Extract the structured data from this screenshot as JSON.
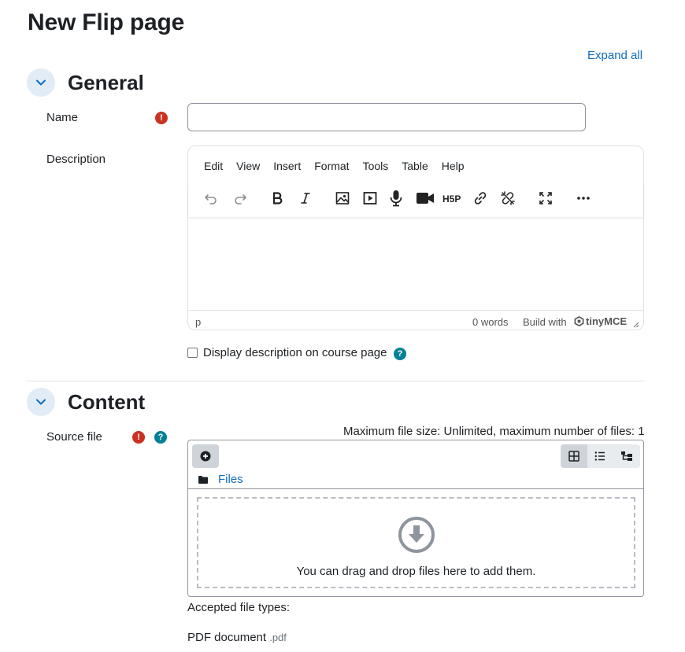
{
  "page": {
    "title": "New Flip page",
    "expand_all": "Expand all"
  },
  "general": {
    "section_title": "General",
    "name_label": "Name",
    "name_value": "",
    "description_label": "Description",
    "editor": {
      "menu": [
        "Edit",
        "View",
        "Insert",
        "Format",
        "Tools",
        "Table",
        "Help"
      ],
      "status_path": "p",
      "word_count": "0 words",
      "build_with": "Build with",
      "brand": "tinyMCE"
    },
    "display_description_label": "Display description on course page",
    "display_description_checked": false
  },
  "content": {
    "section_title": "Content",
    "source_file_label": "Source file",
    "max_file_size": "Maximum file size: Unlimited, maximum number of files: 1",
    "files_path": "Files",
    "drop_text": "You can drag and drop files here to add them.",
    "accepted_label": "Accepted file types:",
    "file_type_name": "PDF document",
    "file_type_ext": ".pdf"
  },
  "colors": {
    "link": "#0f6cbf",
    "required": "#ca3120",
    "help": "#008196",
    "toggle_bg": "#e2ecf6"
  }
}
